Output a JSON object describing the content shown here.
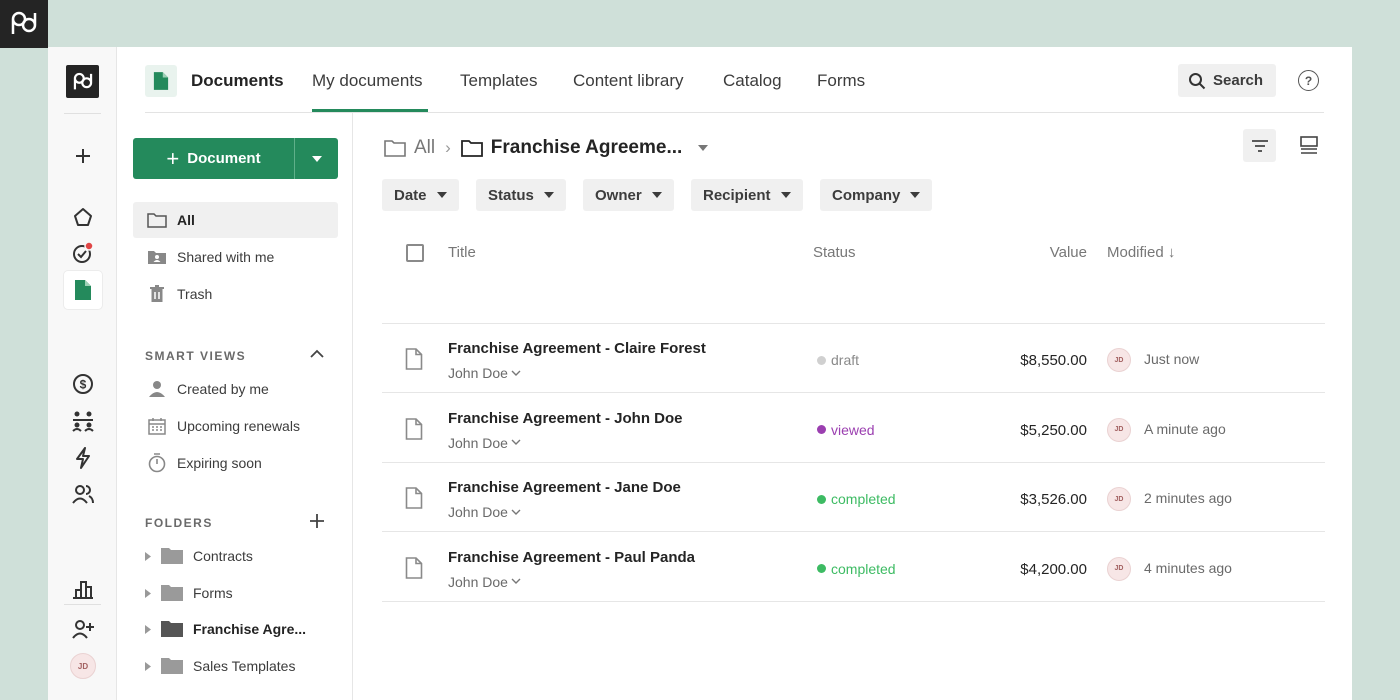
{
  "colors": {
    "brand": "#248a5c",
    "draft": "#d0d0d0",
    "viewed": "#9b3fb0",
    "completed": "#3dbb63",
    "background": "#cfe0d9"
  },
  "rail": {
    "avatar_initials": "JD",
    "icons": [
      "plus-icon",
      "home-icon",
      "tasks-icon",
      "documents-icon",
      "dollar-icon",
      "people-hierarchy-icon",
      "lightning-icon",
      "contacts-icon",
      "chart-icon",
      "add-user-icon"
    ]
  },
  "topbar": {
    "app_title": "Documents",
    "tabs": [
      "My documents",
      "Templates",
      "Content library",
      "Catalog",
      "Forms"
    ],
    "active_tab": "My documents",
    "search_label": "Search",
    "help_label": "?"
  },
  "sidebar": {
    "new_button_label": "Document",
    "nav": [
      "All",
      "Shared with me",
      "Trash"
    ],
    "smart_views_title": "SMART VIEWS",
    "smart_views": [
      "Created by me",
      "Upcoming renewals",
      "Expiring soon"
    ],
    "folders_title": "FOLDERS",
    "folders": [
      "Contracts",
      "Forms",
      "Franchise Agre...",
      "Sales Templates"
    ]
  },
  "main": {
    "breadcrumb": {
      "root": "All",
      "separator": "›",
      "current": "Franchise Agreeme..."
    },
    "filters": [
      "Date",
      "Status",
      "Owner",
      "Recipient",
      "Company"
    ],
    "columns": {
      "title": "Title",
      "status": "Status",
      "value": "Value",
      "modified": "Modified ↓"
    },
    "rows": [
      {
        "title": "Franchise Agreement - Claire Forest",
        "owner": "John Doe",
        "status": "draft",
        "value": "$8,550.00",
        "avatar": "JD",
        "modified": "Just now"
      },
      {
        "title": "Franchise Agreement - John Doe",
        "owner": "John Doe",
        "status": "viewed",
        "value": "$5,250.00",
        "avatar": "JD",
        "modified": "A minute ago"
      },
      {
        "title": "Franchise Agreement - Jane Doe",
        "owner": "John Doe",
        "status": "completed",
        "value": "$3,526.00",
        "avatar": "JD",
        "modified": "2 minutes ago"
      },
      {
        "title": "Franchise Agreement - Paul Panda",
        "owner": "John Doe",
        "status": "completed",
        "value": "$4,200.00",
        "avatar": "JD",
        "modified": "4 minutes ago"
      }
    ]
  }
}
